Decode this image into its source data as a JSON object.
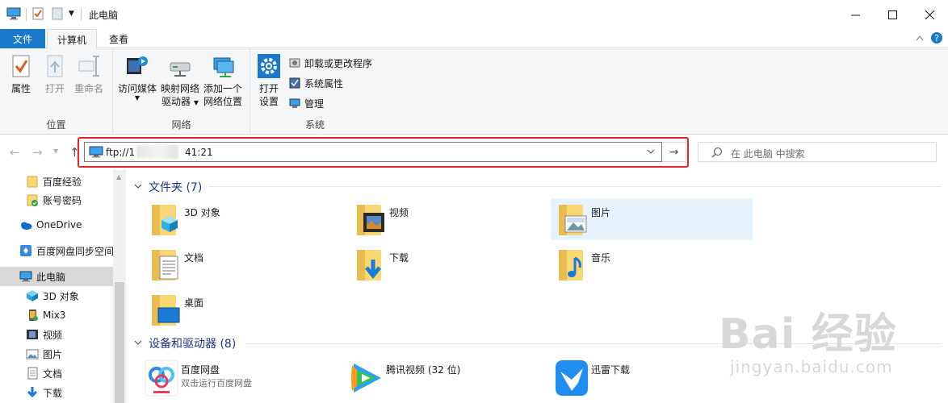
{
  "window": {
    "title": "此电脑",
    "controls": [
      "minimize-icon",
      "maximize-icon",
      "close-icon"
    ]
  },
  "tabs": {
    "file": "文件",
    "computer": "计算机",
    "view": "查看"
  },
  "ribbon": {
    "groups": {
      "location": "位置",
      "network": "网络",
      "system": "系统"
    },
    "buttons": {
      "properties": "属性",
      "open": "打开",
      "rename": "重命名",
      "access_media": "访问媒体",
      "map_drive_1": "映射网络",
      "map_drive_2": "驱动器",
      "add_location_1": "添加一个",
      "add_location_2": "网络位置",
      "open_settings_1": "打开",
      "open_settings_2": "设置",
      "uninstall": "卸载或更改程序",
      "system_properties": "系统属性",
      "manage": "管理"
    }
  },
  "address": {
    "prefix": "ftp://1",
    "suffix": "41:21",
    "search_placeholder": "在 此电脑 中搜索"
  },
  "navpane": {
    "items": [
      {
        "label": "百度经验",
        "icon": "folder-icon"
      },
      {
        "label": "账号密码",
        "icon": "folder-synced-icon"
      },
      {
        "label": "OneDrive",
        "icon": "cloud-icon"
      },
      {
        "label": "百度网盘同步空间",
        "icon": "baidu-sync-icon"
      },
      {
        "label": "此电脑",
        "icon": "computer-icon"
      },
      {
        "label": "3D 对象",
        "icon": "cube-icon"
      },
      {
        "label": "Mix3",
        "icon": "phone-icon"
      },
      {
        "label": "视频",
        "icon": "video-icon"
      },
      {
        "label": "图片",
        "icon": "picture-icon"
      },
      {
        "label": "文档",
        "icon": "document-icon"
      },
      {
        "label": "下载",
        "icon": "download-icon"
      }
    ]
  },
  "content": {
    "folders_header": "文件夹 (7)",
    "folders": [
      "3D 对象",
      "视频",
      "图片",
      "文档",
      "下载",
      "音乐",
      "桌面"
    ],
    "devices_header": "设备和驱动器 (8)",
    "devices": [
      {
        "name": "百度网盘",
        "sub": "双击运行百度网盘"
      },
      {
        "name": "腾讯视频 (32 位)",
        "sub": ""
      },
      {
        "name": "迅雷下载",
        "sub": ""
      }
    ]
  },
  "watermark": {
    "logo": "Bai 经验",
    "url": "jingyan.baidu.com"
  },
  "colors": {
    "accent": "#1979ca",
    "highlight": "#e8212a",
    "header_text": "#1e3287",
    "folder_yellow": "#f8d774"
  }
}
